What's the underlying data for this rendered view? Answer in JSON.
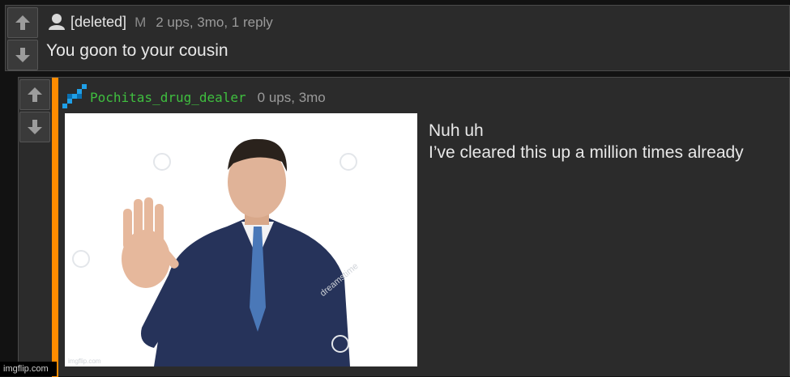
{
  "comment1": {
    "username": "[deleted]",
    "flag": "M",
    "meta": "2 ups, 3mo, 1 reply",
    "body": "You goon to your cousin",
    "avatar_icon": "user-silhouette-icon"
  },
  "comment2": {
    "username": "Pochitas_drug_dealer",
    "meta": "0 ups, 3mo",
    "body_line1": "Nuh uh",
    "body_line2": "I’ve cleared this up a million times already",
    "avatar_icon": "pixel-avatar-icon",
    "accent_color": "#ff8c00",
    "username_color": "#3fbf3f",
    "image": {
      "description_icon": "businessman-waving-hand-photo",
      "watermark": "dreamstime",
      "corner_mark": "imgflip.com"
    }
  },
  "icons": {
    "upvote": "arrow-up-icon",
    "downvote": "arrow-down-icon"
  },
  "watermark": "imgflip.com"
}
